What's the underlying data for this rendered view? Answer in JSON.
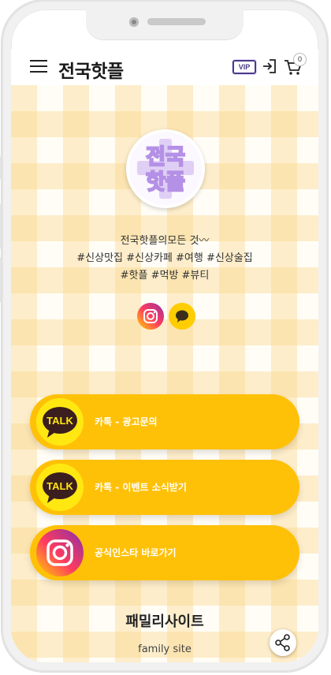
{
  "header": {
    "title": "전국핫플",
    "vip_label": "VIP",
    "cart_count": "0"
  },
  "logo": {
    "line1": "전국",
    "line2": "핫플"
  },
  "profile": {
    "line1": "전국핫플의모든 것〰",
    "line2": "#신상맛집 #신상카페 #여행 #신상술집",
    "line3": "#핫플 #먹방 #뷰티"
  },
  "links": [
    {
      "label": "카톡 - 광고문의",
      "icon": "kakaotalk-icon",
      "icon_text": "TALK"
    },
    {
      "label": "카톡 - 이벤트 소식받기",
      "icon": "kakaotalk-icon",
      "icon_text": "TALK"
    },
    {
      "label": "공식인스타 바로가기",
      "icon": "instagram-icon"
    }
  ],
  "footer": {
    "title": "패밀리사이트",
    "subtitle": "family site"
  },
  "colors": {
    "button": "#ffc107",
    "gingham": "#fad68c",
    "kakao": "#ffe812"
  }
}
